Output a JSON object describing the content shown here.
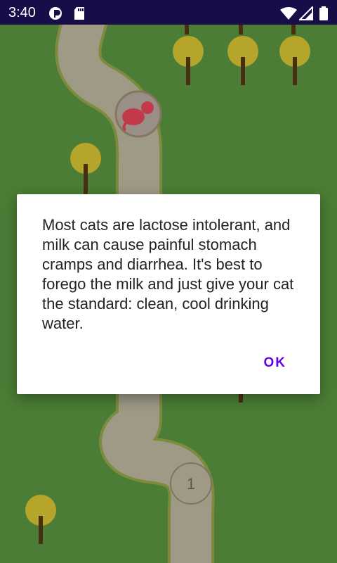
{
  "status_bar": {
    "time": "3:40",
    "icons": [
      "pocket-casts-icon",
      "sd-card-icon",
      "wifi-icon",
      "cell-signal-icon",
      "battery-icon"
    ]
  },
  "map": {
    "level_marker": "1",
    "colors": {
      "grass": "#4b7d36",
      "path": "#9f9a86",
      "tree_canopy": "#b5a52b",
      "trunk": "#4a2e12"
    }
  },
  "dialog": {
    "message": "Most cats are lactose intolerant, and milk can cause painful stomach cramps and diarrhea. It's best to forego the milk and just give your cat the standard: clean, cool drinking water.",
    "ok_label": "OK"
  }
}
